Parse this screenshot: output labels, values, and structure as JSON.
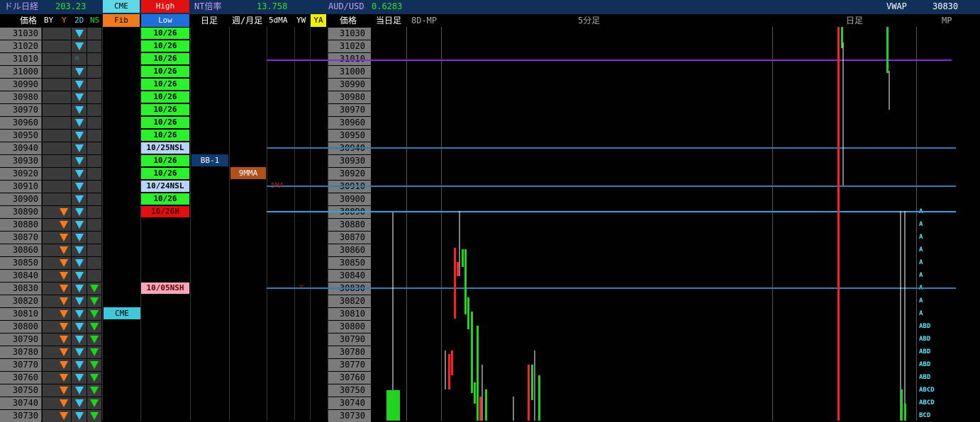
{
  "topbar": {
    "usd_nikkei_label": "ドル日経",
    "usd_nikkei_value": "203.23",
    "cme_label": "CME",
    "high_label": "High",
    "nt_label": "NT倍率",
    "nt_value": "13.758",
    "audusd_label": "AUD/USD",
    "audusd_value": "0.6283",
    "vwap_label": "VWAP",
    "vwap_value": "30830"
  },
  "header": {
    "price": "価格",
    "by": "BY",
    "y": "Y",
    "d2": "2D",
    "ns": "NS",
    "fib": "Fib",
    "low": "Low",
    "daily": "日足",
    "weekly_monthly": "週/月足",
    "ma5d": "5dMA",
    "yw": "YW",
    "ya": "YA",
    "price2": "価格",
    "today_daily": "当日足",
    "mp8d": "8D-MP",
    "min5": "5分足",
    "daily2": "日足",
    "mp": "MP"
  },
  "prices": [
    "31030",
    "31020",
    "31010",
    "31000",
    "30990",
    "30980",
    "30970",
    "30960",
    "30950",
    "30940",
    "30930",
    "30920",
    "30910",
    "30900",
    "30890",
    "30880",
    "30870",
    "30860",
    "30850",
    "30840",
    "30830",
    "30820",
    "30810",
    "30800",
    "30790",
    "30780",
    "30770",
    "30760",
    "30750",
    "30740",
    "30730"
  ],
  "high_low_labels": [
    "10/26",
    "10/26",
    "10/26",
    "10/26",
    "10/26",
    "10/26",
    "10/26",
    "10/26",
    "10/26",
    "10/25NSL",
    "10/26",
    "10/26",
    "10/24NSL",
    "10/26",
    "10/26H",
    "",
    "",
    "",
    "",
    "",
    "10/05NSH",
    "",
    "",
    "",
    "",
    "",
    "",
    "",
    "",
    "",
    ""
  ],
  "markers": {
    "bb": "BB-1",
    "mma9": "9MMA",
    "ma5": "5MA",
    "cme_tag": "CME",
    "y_tag": "Y"
  },
  "tpo_letters": [
    "",
    "",
    "",
    "",
    "",
    "",
    "",
    "",
    "",
    "",
    "",
    "",
    "",
    "",
    "A",
    "A",
    "A",
    "A",
    "A",
    "A",
    "A",
    "A",
    "A",
    "ABD",
    "ABD",
    "ABD",
    "ABD",
    "ABD",
    "ABCD",
    "ABCD",
    "BCD"
  ],
  "colors": {
    "up": "#1fd31f",
    "down": "#ff2020",
    "cyan": "#3cc8f0",
    "orange": "#ff7a1a",
    "purple": "#9932cc",
    "steelblue": "#2a7fb8"
  }
}
